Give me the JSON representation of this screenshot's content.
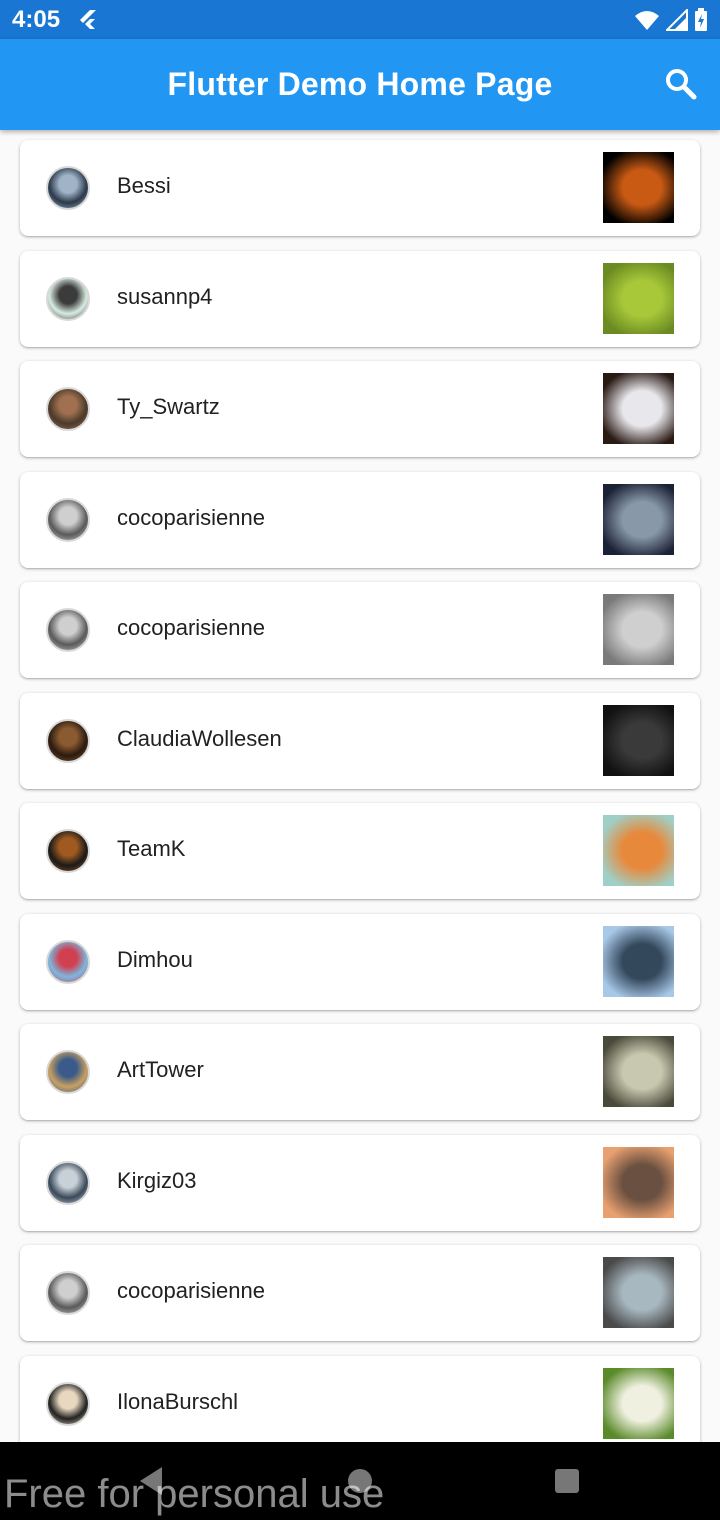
{
  "status_bar": {
    "time": "4:05"
  },
  "app_bar": {
    "title": "Flutter Demo Home Page"
  },
  "items": [
    {
      "username": "Bessi",
      "avatar_colors": [
        "#2b3a4a",
        "#a0b4c8"
      ],
      "thumb_colors": [
        "#000000",
        "#c85a14"
      ],
      "thumb_icon": "moon-cat-silhouette"
    },
    {
      "username": "susannp4",
      "avatar_colors": [
        "#d8ece2",
        "#3b3b3b"
      ],
      "thumb_colors": [
        "#6a8a22",
        "#a8c83a"
      ],
      "thumb_icon": "kitten-grass"
    },
    {
      "username": "Ty_Swartz",
      "avatar_colors": [
        "#4a3a2a",
        "#a07050"
      ],
      "thumb_colors": [
        "#2a1a14",
        "#e8e8ec"
      ],
      "thumb_icon": "white-kitten"
    },
    {
      "username": "cocoparisienne",
      "avatar_colors": [
        "#5a5a5a",
        "#cfcfcf"
      ],
      "thumb_colors": [
        "#1c2236",
        "#8898a8"
      ],
      "thumb_icon": "cat-eye-closeup"
    },
    {
      "username": "cocoparisienne",
      "avatar_colors": [
        "#5a5a5a",
        "#cfcfcf"
      ],
      "thumb_colors": [
        "#7a7a7a",
        "#cfcfcf"
      ],
      "thumb_icon": "tabby-face"
    },
    {
      "username": "ClaudiaWollesen",
      "avatar_colors": [
        "#2a1a10",
        "#8a5a30"
      ],
      "thumb_colors": [
        "#111111",
        "#3a3a3a"
      ],
      "thumb_icon": "black-cat"
    },
    {
      "username": "TeamK",
      "avatar_colors": [
        "#1a1a1a",
        "#a05a20"
      ],
      "thumb_colors": [
        "#9fd0c8",
        "#e8883a"
      ],
      "thumb_icon": "cats-grooming"
    },
    {
      "username": "Dimhou",
      "avatar_colors": [
        "#7ab8e0",
        "#d04050"
      ],
      "thumb_colors": [
        "#a8c8e8",
        "#34485c"
      ],
      "thumb_icon": "kitten-rocks"
    },
    {
      "username": "ArtTower",
      "avatar_colors": [
        "#c8a060",
        "#3a5a8a"
      ],
      "thumb_colors": [
        "#4a4a3a",
        "#c8c8b0"
      ],
      "thumb_icon": "tabby-tongue"
    },
    {
      "username": "Kirgiz03",
      "avatar_colors": [
        "#3a4a5a",
        "#c8d0d8"
      ],
      "thumb_colors": [
        "#e8a070",
        "#6a5040"
      ],
      "thumb_icon": "sitting-kitten"
    },
    {
      "username": "cocoparisienne",
      "avatar_colors": [
        "#5a5a5a",
        "#cfcfcf"
      ],
      "thumb_colors": [
        "#4a4a4a",
        "#a8b8c0"
      ],
      "thumb_icon": "tabby-blue-eyes"
    },
    {
      "username": "IlonaBurschl",
      "avatar_colors": [
        "#222222",
        "#e8d8c0"
      ],
      "thumb_colors": [
        "#5a8a2a",
        "#f0f0e0"
      ],
      "thumb_icon": "kitten-daisies"
    }
  ],
  "watermark": "Free for personal use"
}
